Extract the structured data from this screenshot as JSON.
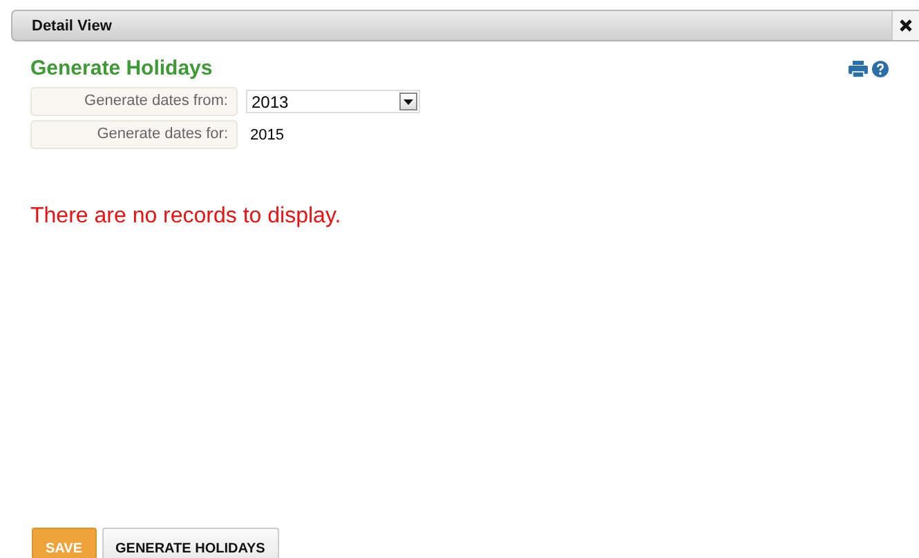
{
  "window": {
    "title": "Detail View"
  },
  "form": {
    "title": "Generate Holidays",
    "fields": [
      {
        "kind": "dropdown",
        "label": "Generate dates from:",
        "value": "2013"
      },
      {
        "kind": "text",
        "label": "Generate dates for:",
        "value": "2015"
      }
    ]
  },
  "message": "There are no records to display.",
  "buttons": [
    {
      "label": "SAVE",
      "kind": "primary"
    },
    {
      "label": "GENERATE HOLIDAYS",
      "kind": "secondary"
    }
  ]
}
